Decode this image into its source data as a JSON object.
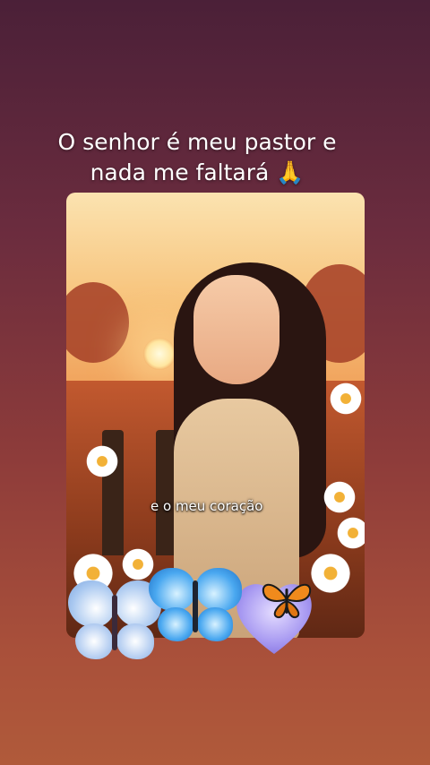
{
  "video": {
    "caption": "O senhor é meu pastor e nada me faltará 🙏",
    "subtitle": "e o meu coração"
  },
  "decor": {
    "butterflies": [
      "blue-butterfly",
      "blue-butterfly",
      "monarch-butterfly"
    ],
    "heart": "lavender-heart"
  }
}
